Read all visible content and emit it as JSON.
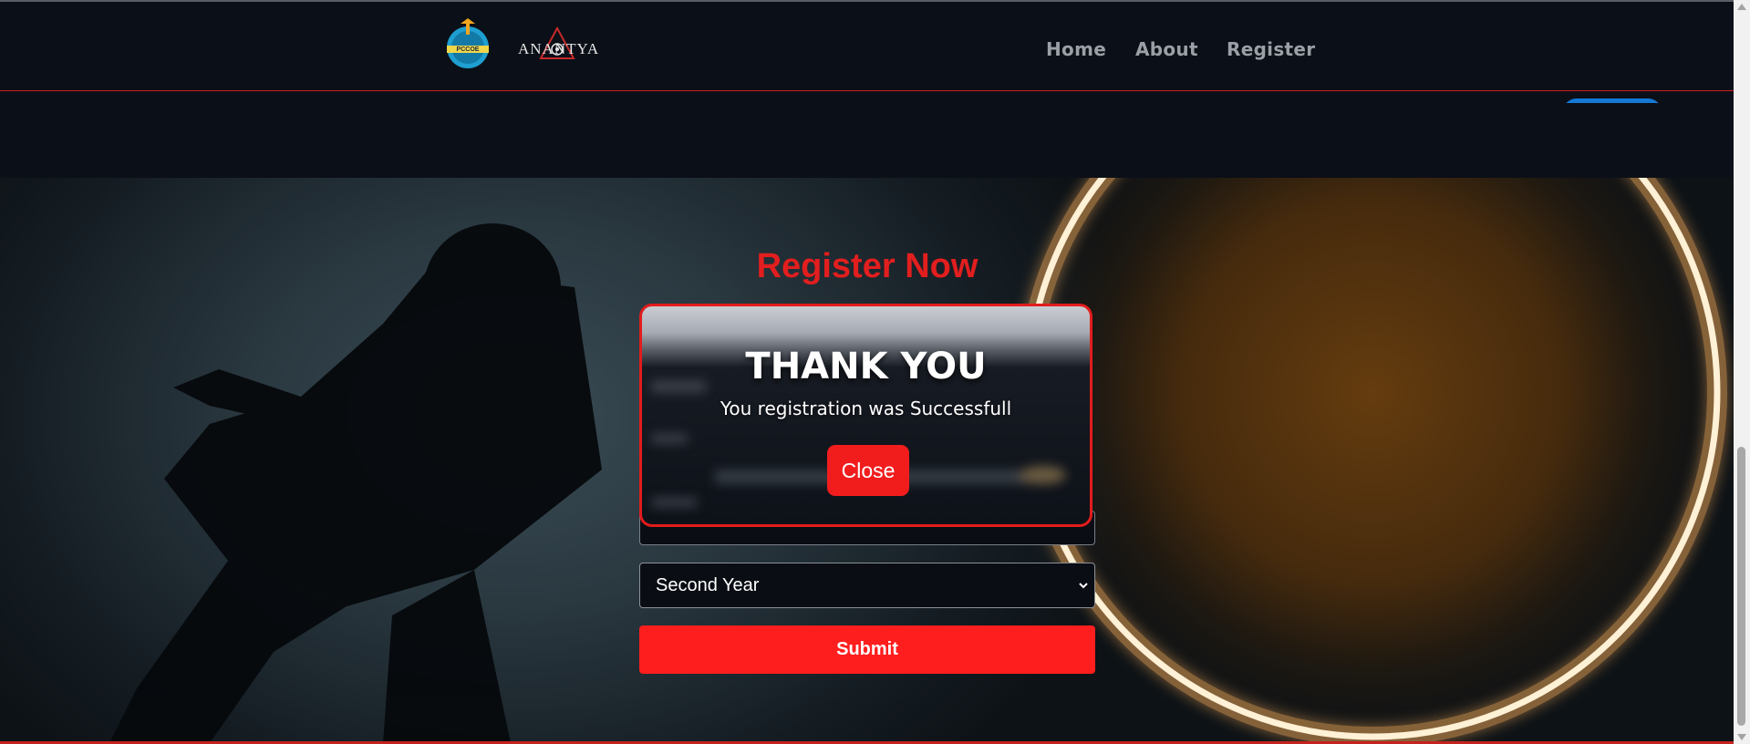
{
  "navbar": {
    "logos": {
      "left": "pccoe-logo",
      "right": "anantya-logo"
    },
    "logo_text": {
      "pccoe": "PCCOE",
      "anantya": "ANANTYA"
    },
    "links": [
      {
        "label": "Home"
      },
      {
        "label": "About"
      },
      {
        "label": "Register"
      }
    ]
  },
  "form": {
    "title": "Register Now",
    "year_select": {
      "selected": "Second Year",
      "icon": "chevron-down-icon"
    },
    "submit_label": "Submit"
  },
  "modal": {
    "title": "THANK YOU",
    "message": "You registration was Successfull",
    "close_label": "Close"
  },
  "colors": {
    "accent_red": "#ff1e1e",
    "title_red": "#e21e1e",
    "background": "#0b0f17",
    "nav_text": "#9aa0a6",
    "blue_pill": "#1479d6"
  }
}
